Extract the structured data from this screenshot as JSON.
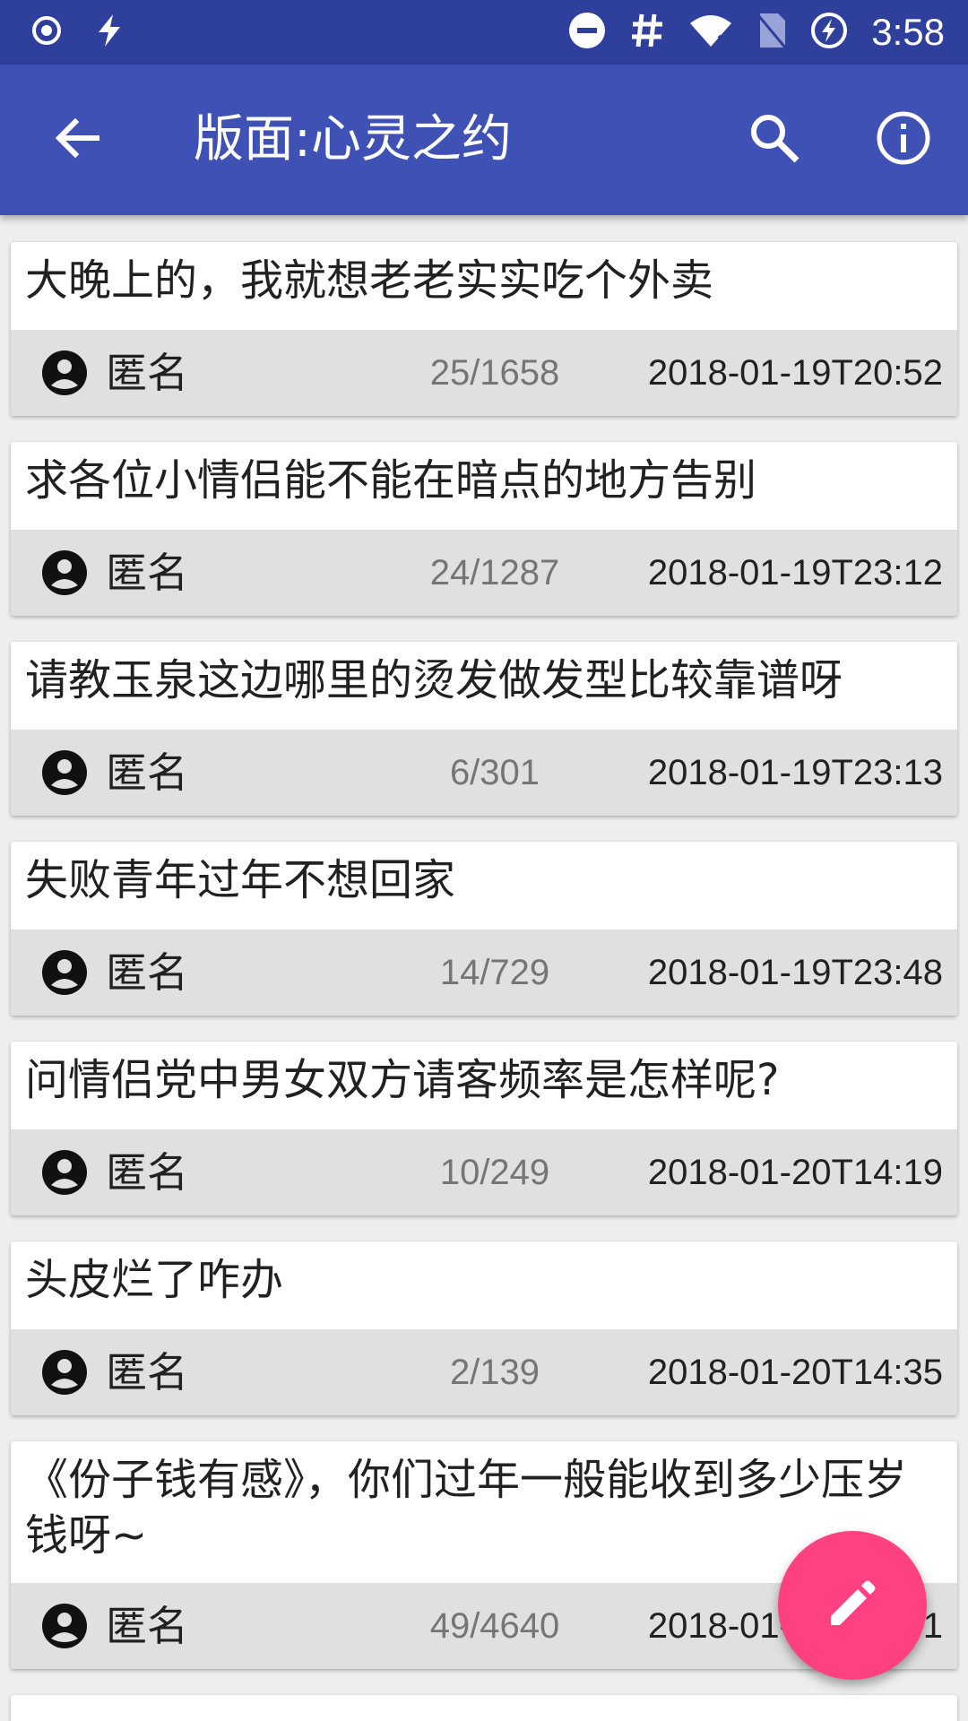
{
  "status_bar": {
    "time": "3:58",
    "left_icons": [
      "radio-button-icon",
      "flash-icon"
    ],
    "right_icons": [
      "do-not-disturb-icon",
      "hash-icon",
      "wifi-off-icon",
      "no-sim-icon",
      "battery-charging-icon"
    ]
  },
  "app_bar": {
    "title": "版面:心灵之约",
    "back_icon": "arrow-back-icon",
    "search_icon": "search-icon",
    "info_icon": "info-icon"
  },
  "posts": [
    {
      "title": "大晚上的，我就想老老实实吃个外卖",
      "author": "匿名",
      "counts": "25/1658",
      "time": "2018-01-19T20:52"
    },
    {
      "title": "求各位小情侣能不能在暗点的地方告别",
      "author": "匿名",
      "counts": "24/1287",
      "time": "2018-01-19T23:12"
    },
    {
      "title": "请教玉泉这边哪里的烫发做发型比较靠谱呀",
      "author": "匿名",
      "counts": "6/301",
      "time": "2018-01-19T23:13"
    },
    {
      "title": "失败青年过年不想回家",
      "author": "匿名",
      "counts": "14/729",
      "time": "2018-01-19T23:48"
    },
    {
      "title": "问情侣党中男女双方请客频率是怎样呢?",
      "author": "匿名",
      "counts": "10/249",
      "time": "2018-01-20T14:19"
    },
    {
      "title": "头皮烂了咋办",
      "author": "匿名",
      "counts": "2/139",
      "time": "2018-01-20T14:35"
    },
    {
      "title": "《份子钱有感》，你们过年一般能收到多少压岁钱呀~",
      "author": "匿名",
      "counts": "49/4640",
      "time": "2018-01-20T15:01"
    }
  ],
  "fab": {
    "icon": "edit-pencil-icon"
  },
  "colors": {
    "primary": "#3f51b5",
    "primary_dark": "#2e3f9c",
    "accent": "#ff4081",
    "meta_bg": "#e0e0e0"
  }
}
